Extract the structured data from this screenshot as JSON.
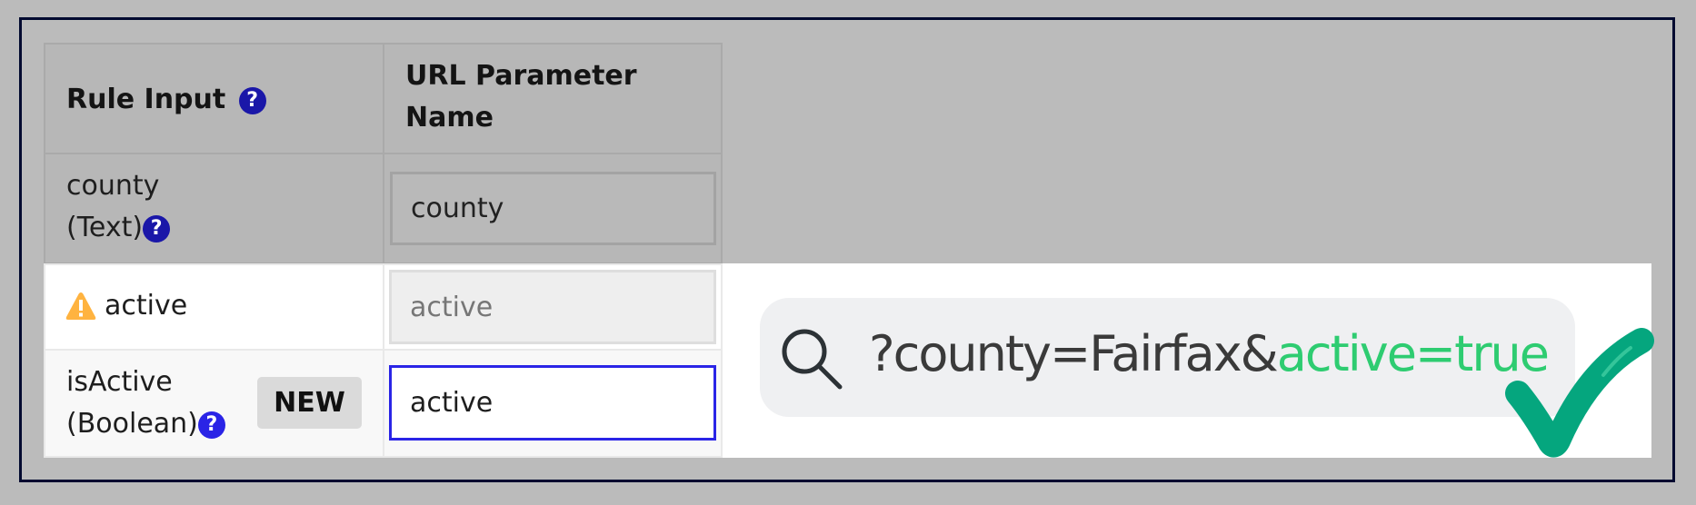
{
  "table": {
    "headers": [
      {
        "label": "Rule Input",
        "help_icon": "question-circle-icon"
      },
      {
        "label": "URL Parameter Name"
      }
    ],
    "header_lines": [
      "URL Parameter",
      "Name"
    ],
    "rows": [
      {
        "input_name": "county",
        "input_type": "(Text)",
        "help_icon": "question-circle-icon",
        "param_value": "county",
        "state": "dimmed"
      },
      {
        "input_name": "active",
        "warning_icon": "warning-triangle-icon",
        "param_value": "active",
        "state": "disabled"
      },
      {
        "input_name": "isActive",
        "input_type": "(Boolean)",
        "help_icon": "question-circle-icon",
        "badge": "NEW",
        "param_value": "active",
        "state": "focused"
      }
    ]
  },
  "url_preview": {
    "icon": "search-icon",
    "base": "?county=Fairfax&",
    "highlight": "active=true",
    "highlight_color": "#2ecc71",
    "status_icon": "checkmark-icon",
    "status_color": "#05a67e"
  },
  "colors": {
    "focus_border": "#2a24e6",
    "warning": "#ffb340",
    "frame_border": "#020a30"
  }
}
